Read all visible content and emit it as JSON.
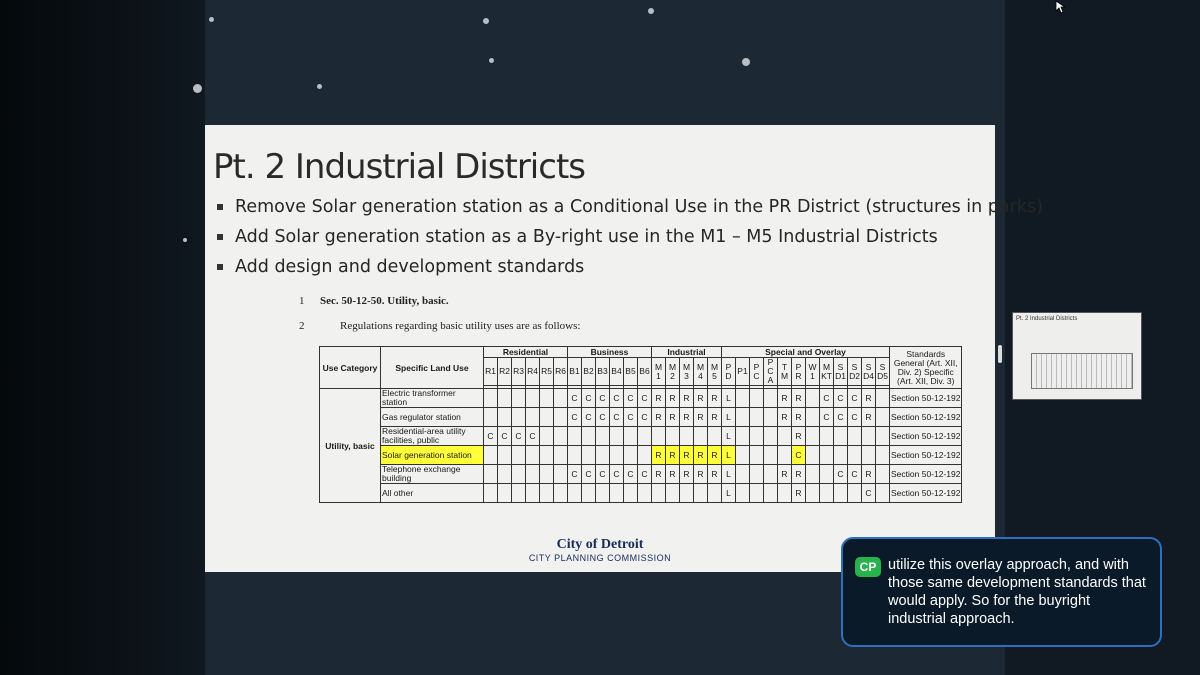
{
  "slide": {
    "title": "Pt. 2 Industrial Districts",
    "bullets": [
      "Remove Solar generation station as a Conditional Use in the PR District (structures in parks)",
      "Add Solar generation station as a By-right use in the M1 – M5 Industrial Districts",
      "Add design and development standards"
    ],
    "line1_num": "1",
    "line1_text": "Sec. 50-12-50. Utility, basic.",
    "line2_num": "2",
    "line2_text": "Regulations regarding basic utility uses are as follows:"
  },
  "table": {
    "header_use_category": "Use Category",
    "header_specific_land_use": "Specific Land Use",
    "groups": [
      "Residential",
      "Business",
      "Industrial",
      "Special and Overlay"
    ],
    "standards_header": "Standards General (Art. XII, Div. 2) Specific (Art. XII, Div. 3)",
    "columns": [
      "R1",
      "R2",
      "R3",
      "R4",
      "R5",
      "R6",
      "B1",
      "B2",
      "B3",
      "B4",
      "B5",
      "B6",
      "M1",
      "M2",
      "M3",
      "M4",
      "M5",
      "PD",
      "P1",
      "PC",
      "PCA",
      "TM",
      "PR",
      "W1",
      "MKT",
      "SD1",
      "SD2",
      "SD4",
      "SD5"
    ],
    "category": "Utility, basic",
    "rows": [
      {
        "use": "Electric transformer station",
        "cells": [
          "",
          "",
          "",
          "",
          "",
          "",
          "C",
          "C",
          "C",
          "C",
          "C",
          "C",
          "R",
          "R",
          "R",
          "R",
          "R",
          "L",
          "",
          "",
          "",
          "R",
          "R",
          "",
          "C",
          "C",
          "C",
          "R",
          ""
        ],
        "standard": "Section 50-12-192"
      },
      {
        "use": "Gas regulator station",
        "cells": [
          "",
          "",
          "",
          "",
          "",
          "",
          "C",
          "C",
          "C",
          "C",
          "C",
          "C",
          "R",
          "R",
          "R",
          "R",
          "R",
          "L",
          "",
          "",
          "",
          "R",
          "R",
          "",
          "C",
          "C",
          "C",
          "R",
          ""
        ],
        "standard": "Section 50-12-192"
      },
      {
        "use": "Residential-area utility facilities, public",
        "cells": [
          "C",
          "C",
          "C",
          "C",
          "",
          "",
          "",
          "",
          "",
          "",
          "",
          "",
          "",
          "",
          "",
          "",
          "",
          "L",
          "",
          "",
          "",
          "",
          "R",
          "",
          "",
          "",
          "",
          "",
          ""
        ],
        "standard": "Section 50-12-192"
      },
      {
        "use": "Solar generation station",
        "cells": [
          "",
          "",
          "",
          "",
          "",
          "",
          "",
          "",
          "",
          "",
          "",
          "",
          "R",
          "R",
          "R",
          "R",
          "R",
          "L",
          "",
          "",
          "",
          "",
          "C",
          "",
          "",
          "",
          "",
          "",
          ""
        ],
        "standard": "Section 50-12-192",
        "highlight": true
      },
      {
        "use": "Telephone exchange building",
        "cells": [
          "",
          "",
          "",
          "",
          "",
          "",
          "C",
          "C",
          "C",
          "C",
          "C",
          "C",
          "R",
          "R",
          "R",
          "R",
          "R",
          "L",
          "",
          "",
          "",
          "R",
          "R",
          "",
          "",
          "C",
          "C",
          "R",
          ""
        ],
        "standard": "Section 50-12-192"
      },
      {
        "use": "All other",
        "cells": [
          "",
          "",
          "",
          "",
          "",
          "",
          "",
          "",
          "",
          "",
          "",
          "",
          "",
          "",
          "",
          "",
          "",
          "L",
          "",
          "",
          "",
          "",
          "R",
          "",
          "",
          "",
          "",
          "C",
          ""
        ],
        "standard": "Section 50-12-192"
      }
    ]
  },
  "logo": {
    "line1": "City of Detroit",
    "line2": "CITY PLANNING COMMISSION"
  },
  "thumbnail": {
    "title": "Pt. 2 Industrial Districts"
  },
  "chat": {
    "avatar": "CP",
    "message": "utilize this overlay approach, and with those same development standards that would apply. So for the buyright industrial approach."
  },
  "icons": {
    "cursor": "arrow-cursor-icon"
  }
}
